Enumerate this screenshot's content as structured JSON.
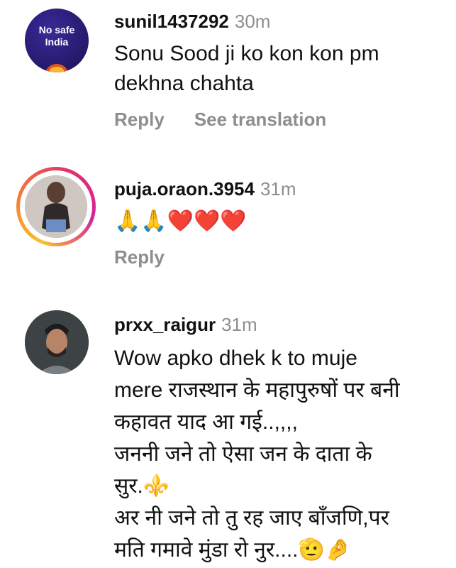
{
  "comments": [
    {
      "username": "sunil1437292",
      "time": "30m",
      "avatar_text_1": "No safe",
      "avatar_text_2": "India",
      "lines": [
        "Sonu Sood ji ko kon kon pm",
        "dekhna chahta"
      ],
      "reply_label": "Reply",
      "translate_label": "See translation"
    },
    {
      "username": "puja.oraon.3954",
      "time": "31m",
      "lines": [
        "🙏🙏❤️❤️❤️"
      ],
      "reply_label": "Reply"
    },
    {
      "username": "prxx_raigur",
      "time": "31m",
      "lines": [
        "Wow apko dhek k to muje",
        "mere राजस्थान के महापुरुषों पर बनी",
        "कहावत याद आ गई..,,,,",
        "जननी जने तो ऐसा जन के दाता के",
        "सुर.⚜️",
        "अर नी जने तो तु रह जाए बाँजणि,पर",
        "मति गमावे मुंडा रो नुर....🫡🤌"
      ]
    }
  ],
  "colors": {
    "username": "#111111",
    "muted": "#8e8e8e",
    "avatar1_bg": "#2b1d6e",
    "story_ring_start": "#f9c22b",
    "story_ring_end": "#d6249f"
  }
}
